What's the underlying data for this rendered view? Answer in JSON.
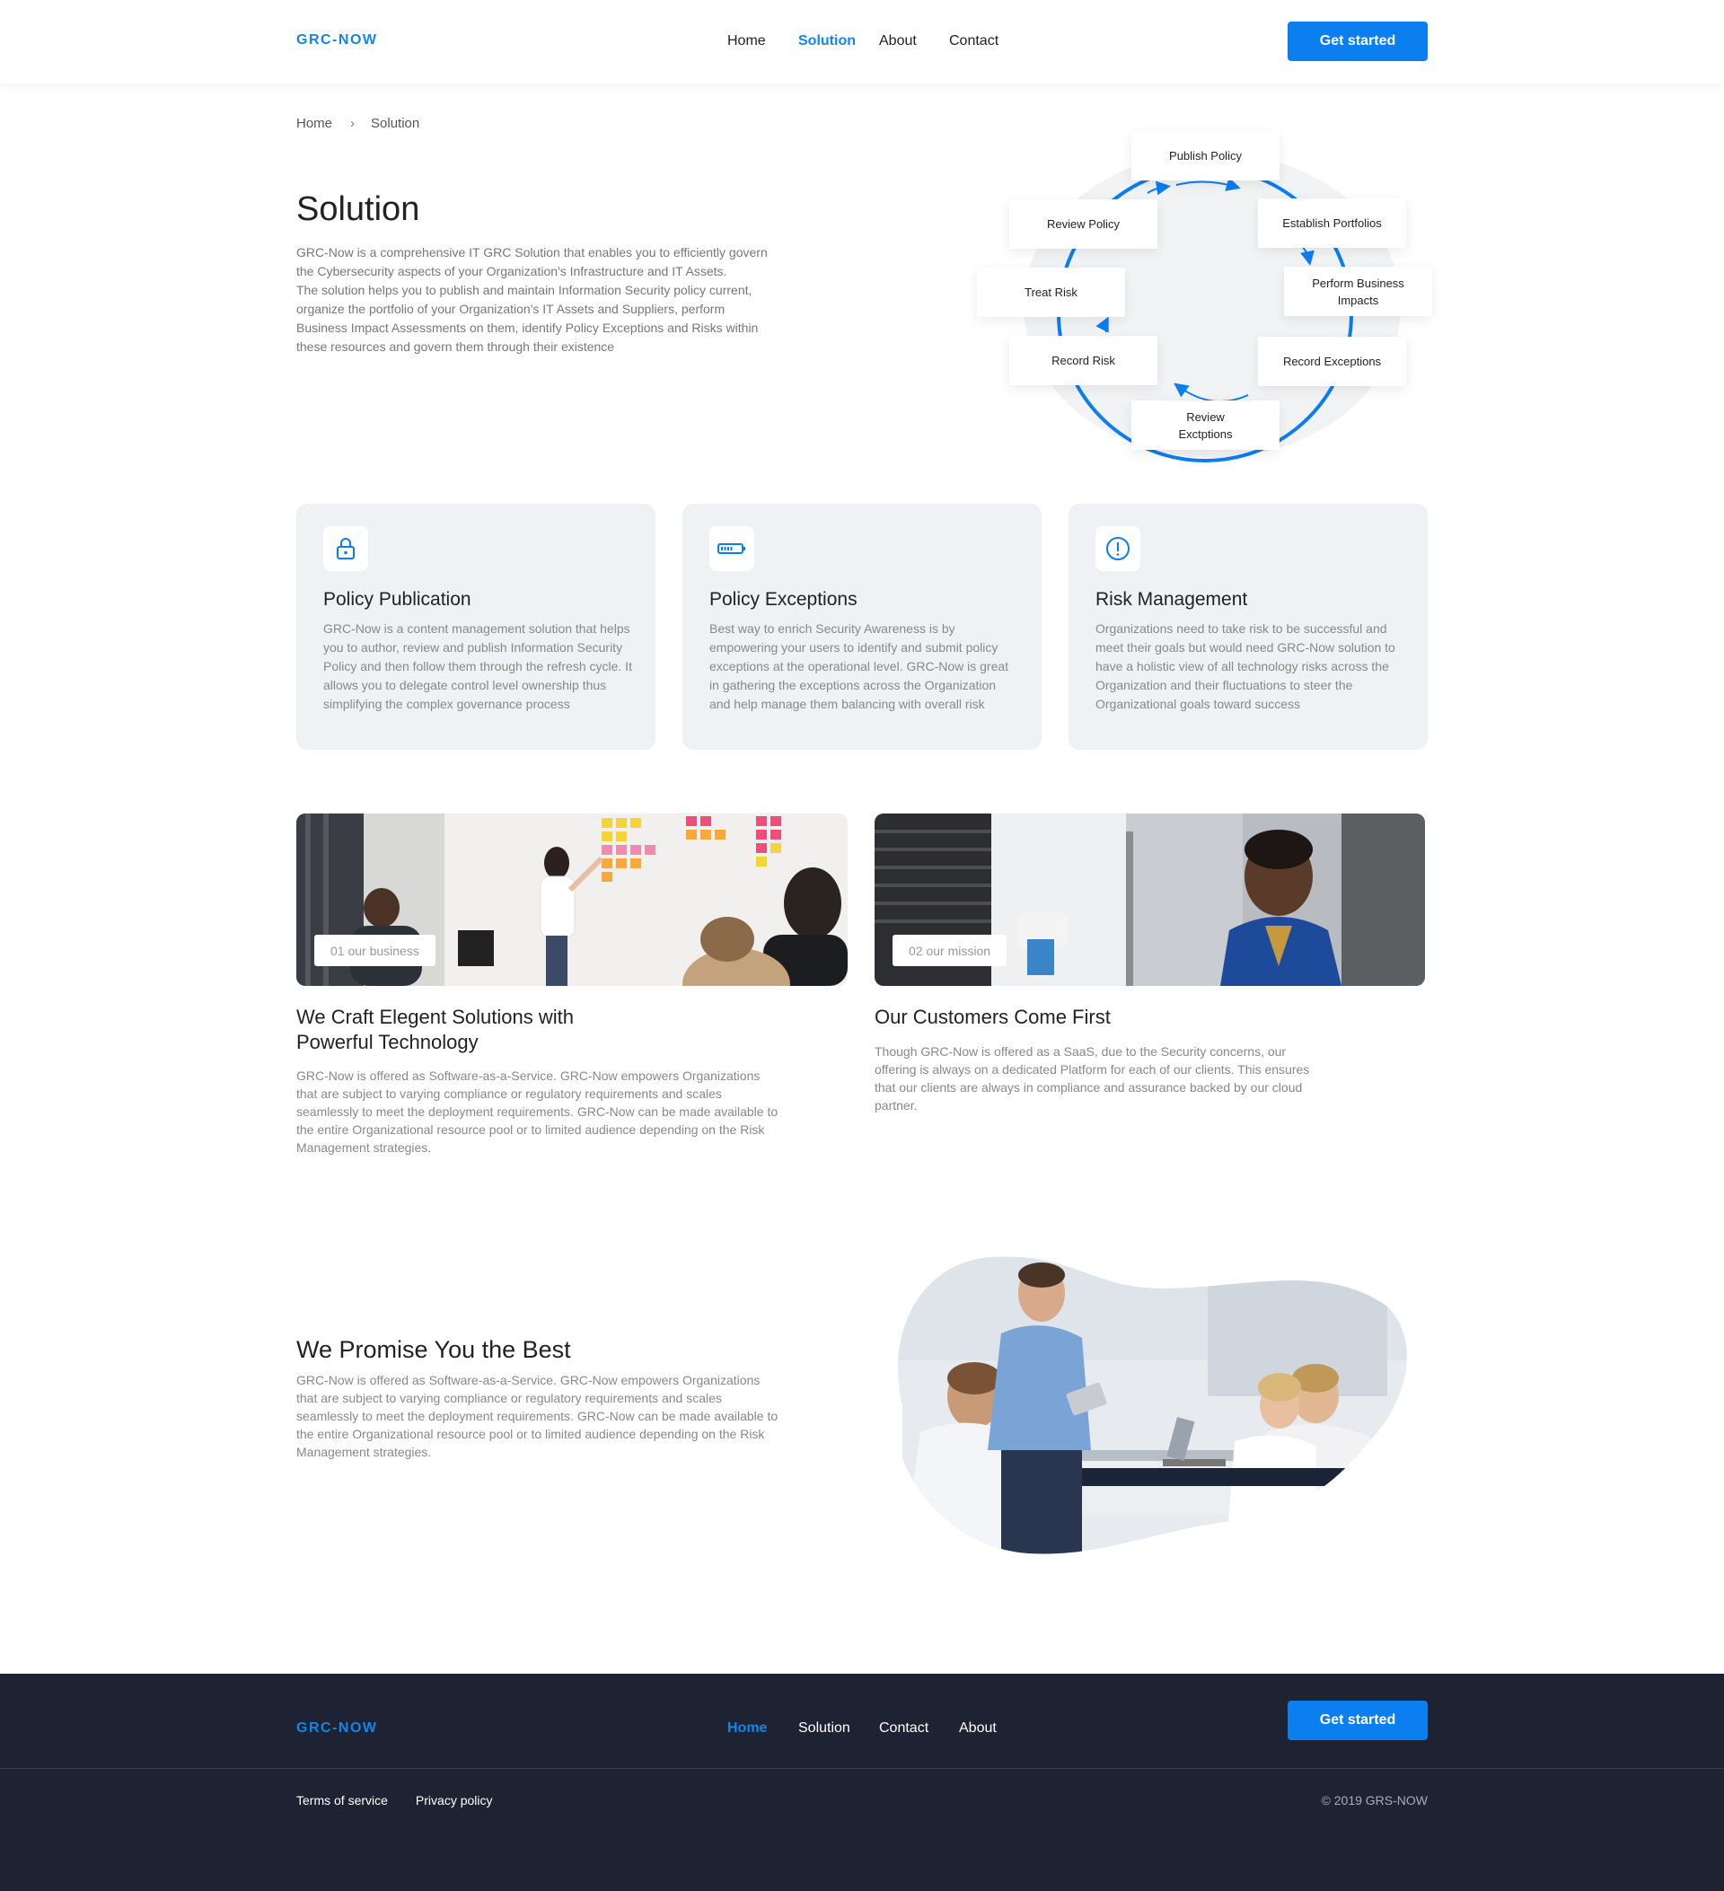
{
  "header": {
    "logo": "GRC-NOW",
    "nav": [
      "Home",
      "Solution",
      "About",
      "Contact"
    ],
    "active_nav": "Solution",
    "cta": "Get started"
  },
  "breadcrumb": {
    "home": "Home",
    "current": "Solution"
  },
  "hero": {
    "title": "Solution",
    "text": "GRC-Now is a comprehensive IT GRC Solution that enables you to efficiently govern\nthe Cybersecurity aspects of your Organization's Infrastructure and  IT Assets.\nThe solution helps you to publish and maintain Information Security policy current,\norganize the portfolio of your Organization's IT Assets and Suppliers, perform\nBusiness Impact Assessments on them, identify Policy Exceptions and Risks within\nthese resources and govern them through their existence"
  },
  "cycle": {
    "steps": [
      "Publish Policy",
      "Establish Portfolios",
      "Perform Business Impacts",
      "Record Exceptions",
      "Review Exctptions",
      "Record Risk",
      "Treat Risk",
      "Review Policy"
    ],
    "accent": "#0b7ef0"
  },
  "features": [
    {
      "icon": "lock-icon",
      "title": "Policy Publication",
      "text": "GRC-Now is a content management solution that helps you to author, review and publish Information Security Policy and then follow them through the refresh cycle. It allows you to delegate control level ownership thus simplifying the complex governance process"
    },
    {
      "icon": "battery-icon",
      "title": "Policy Exceptions",
      "text": "Best way to enrich Security Awareness is by empowering your users to identify and  submit policy exceptions at the operational  level. GRC-Now is great in gathering the exceptions across the Organization and help manage them balancing with overall risk"
    },
    {
      "icon": "alert-circle-icon",
      "title": "Risk Management",
      "text": "Organizations need to take risk to be successful and meet their goals but would need GRC-Now solution to have a holistic view of all technology risks across the Organization and their fluctuations to steer the Organizational goals toward success"
    }
  ],
  "business": {
    "tag": "01 our business",
    "title": "We Craft Elegent Solutions with Powerful Technology",
    "text": "GRC-Now is offered as Software-as-a-Service. GRC-Now empowers Organizations that are subject to varying compliance or regulatory requirements and scales seamlessly to meet the deployment requirements. GRC-Now can be made available to the entire Organizational resource pool or to limited audience depending on the Risk Management strategies."
  },
  "mission": {
    "tag": "02 our mission",
    "title": "Our Customers Come First",
    "text": "Though GRC-Now is offered as a SaaS, due to the Security concerns, our offering is always on a dedicated Platform for each of our clients. This ensures that our clients are always in compliance and assurance backed by our cloud partner."
  },
  "promise": {
    "title": "We Promise You the Best",
    "text": "GRC-Now is offered as Software-as-a-Service. GRC-Now empowers Organizations that are subject to varying compliance or regulatory requirements and scales seamlessly to meet the deployment requirements. GRC-Now can be made available to the entire Organizational resource pool or to limited audience depending on the Risk Management strategies."
  },
  "footer": {
    "logo": "GRC-NOW",
    "nav": [
      "Home",
      "Solution",
      "Contact",
      "About"
    ],
    "active_nav": "Home",
    "cta": "Get started",
    "links": [
      "Terms of service",
      "Privacy policy"
    ],
    "copyright": "© 2019 GRS-NOW"
  }
}
